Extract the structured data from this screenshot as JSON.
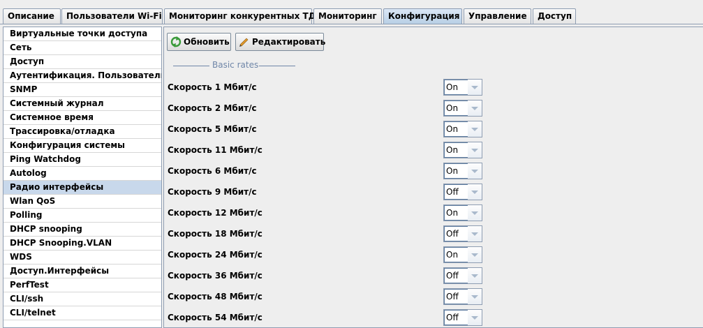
{
  "tabs": [
    {
      "label": "Описание",
      "active": false
    },
    {
      "label": "Пользователи Wi-Fi",
      "active": false
    },
    {
      "label": "Мониторинг конкурентных ТД",
      "active": false
    },
    {
      "label": "Мониторинг",
      "active": false
    },
    {
      "label": "Конфигурация",
      "active": true
    },
    {
      "label": "Управление",
      "active": false
    },
    {
      "label": "Доступ",
      "active": false
    }
  ],
  "sidebar": {
    "selected_index": 11,
    "items": [
      {
        "label": "Виртуальные точки доступа"
      },
      {
        "label": "Сеть"
      },
      {
        "label": "Доступ"
      },
      {
        "label": "Аутентификация. Пользователи"
      },
      {
        "label": "SNMP"
      },
      {
        "label": "Системный журнал"
      },
      {
        "label": "Системное время"
      },
      {
        "label": "Трассировка/отладка"
      },
      {
        "label": "Конфигурация системы"
      },
      {
        "label": "Ping Watchdog"
      },
      {
        "label": "Autolog"
      },
      {
        "label": "Радио интерфейсы"
      },
      {
        "label": "Wlan QoS"
      },
      {
        "label": "Polling"
      },
      {
        "label": "DHCP snooping"
      },
      {
        "label": "DHCP Snooping.VLAN"
      },
      {
        "label": "WDS"
      },
      {
        "label": "Доступ.Интерфейсы"
      },
      {
        "label": "PerfTest"
      },
      {
        "label": "CLI/ssh"
      },
      {
        "label": "CLI/telnet"
      }
    ]
  },
  "toolbar": {
    "refresh_label": "Обновить",
    "edit_label": "Редактировать",
    "refresh_icon": "refresh-icon",
    "edit_icon": "pencil-icon"
  },
  "group": {
    "title": "Basic rates",
    "rates": [
      {
        "label": "Скорость 1 Мбит/с",
        "value": "On"
      },
      {
        "label": "Скорость 2 Мбит/с",
        "value": "On"
      },
      {
        "label": "Скорость 5 Мбит/с",
        "value": "On"
      },
      {
        "label": "Скорость 11 Мбит/с",
        "value": "On"
      },
      {
        "label": "Скорость 6 Мбит/с",
        "value": "On"
      },
      {
        "label": "Скорость 9 Мбит/с",
        "value": "Off"
      },
      {
        "label": "Скорость 12 Мбит/с",
        "value": "On"
      },
      {
        "label": "Скорость 18 Мбит/с",
        "value": "Off"
      },
      {
        "label": "Скорость 24 Мбит/с",
        "value": "On"
      },
      {
        "label": "Скорость 36 Мбит/с",
        "value": "Off"
      },
      {
        "label": "Скорость 48 Мбит/с",
        "value": "Off"
      },
      {
        "label": "Скорость 54 Мбит/с",
        "value": "Off"
      }
    ]
  },
  "colors": {
    "accent": "#6f86a8",
    "tab_active": "#c5d8ee",
    "list_selected": "#c8d8eb",
    "border": "#8e9db2"
  }
}
